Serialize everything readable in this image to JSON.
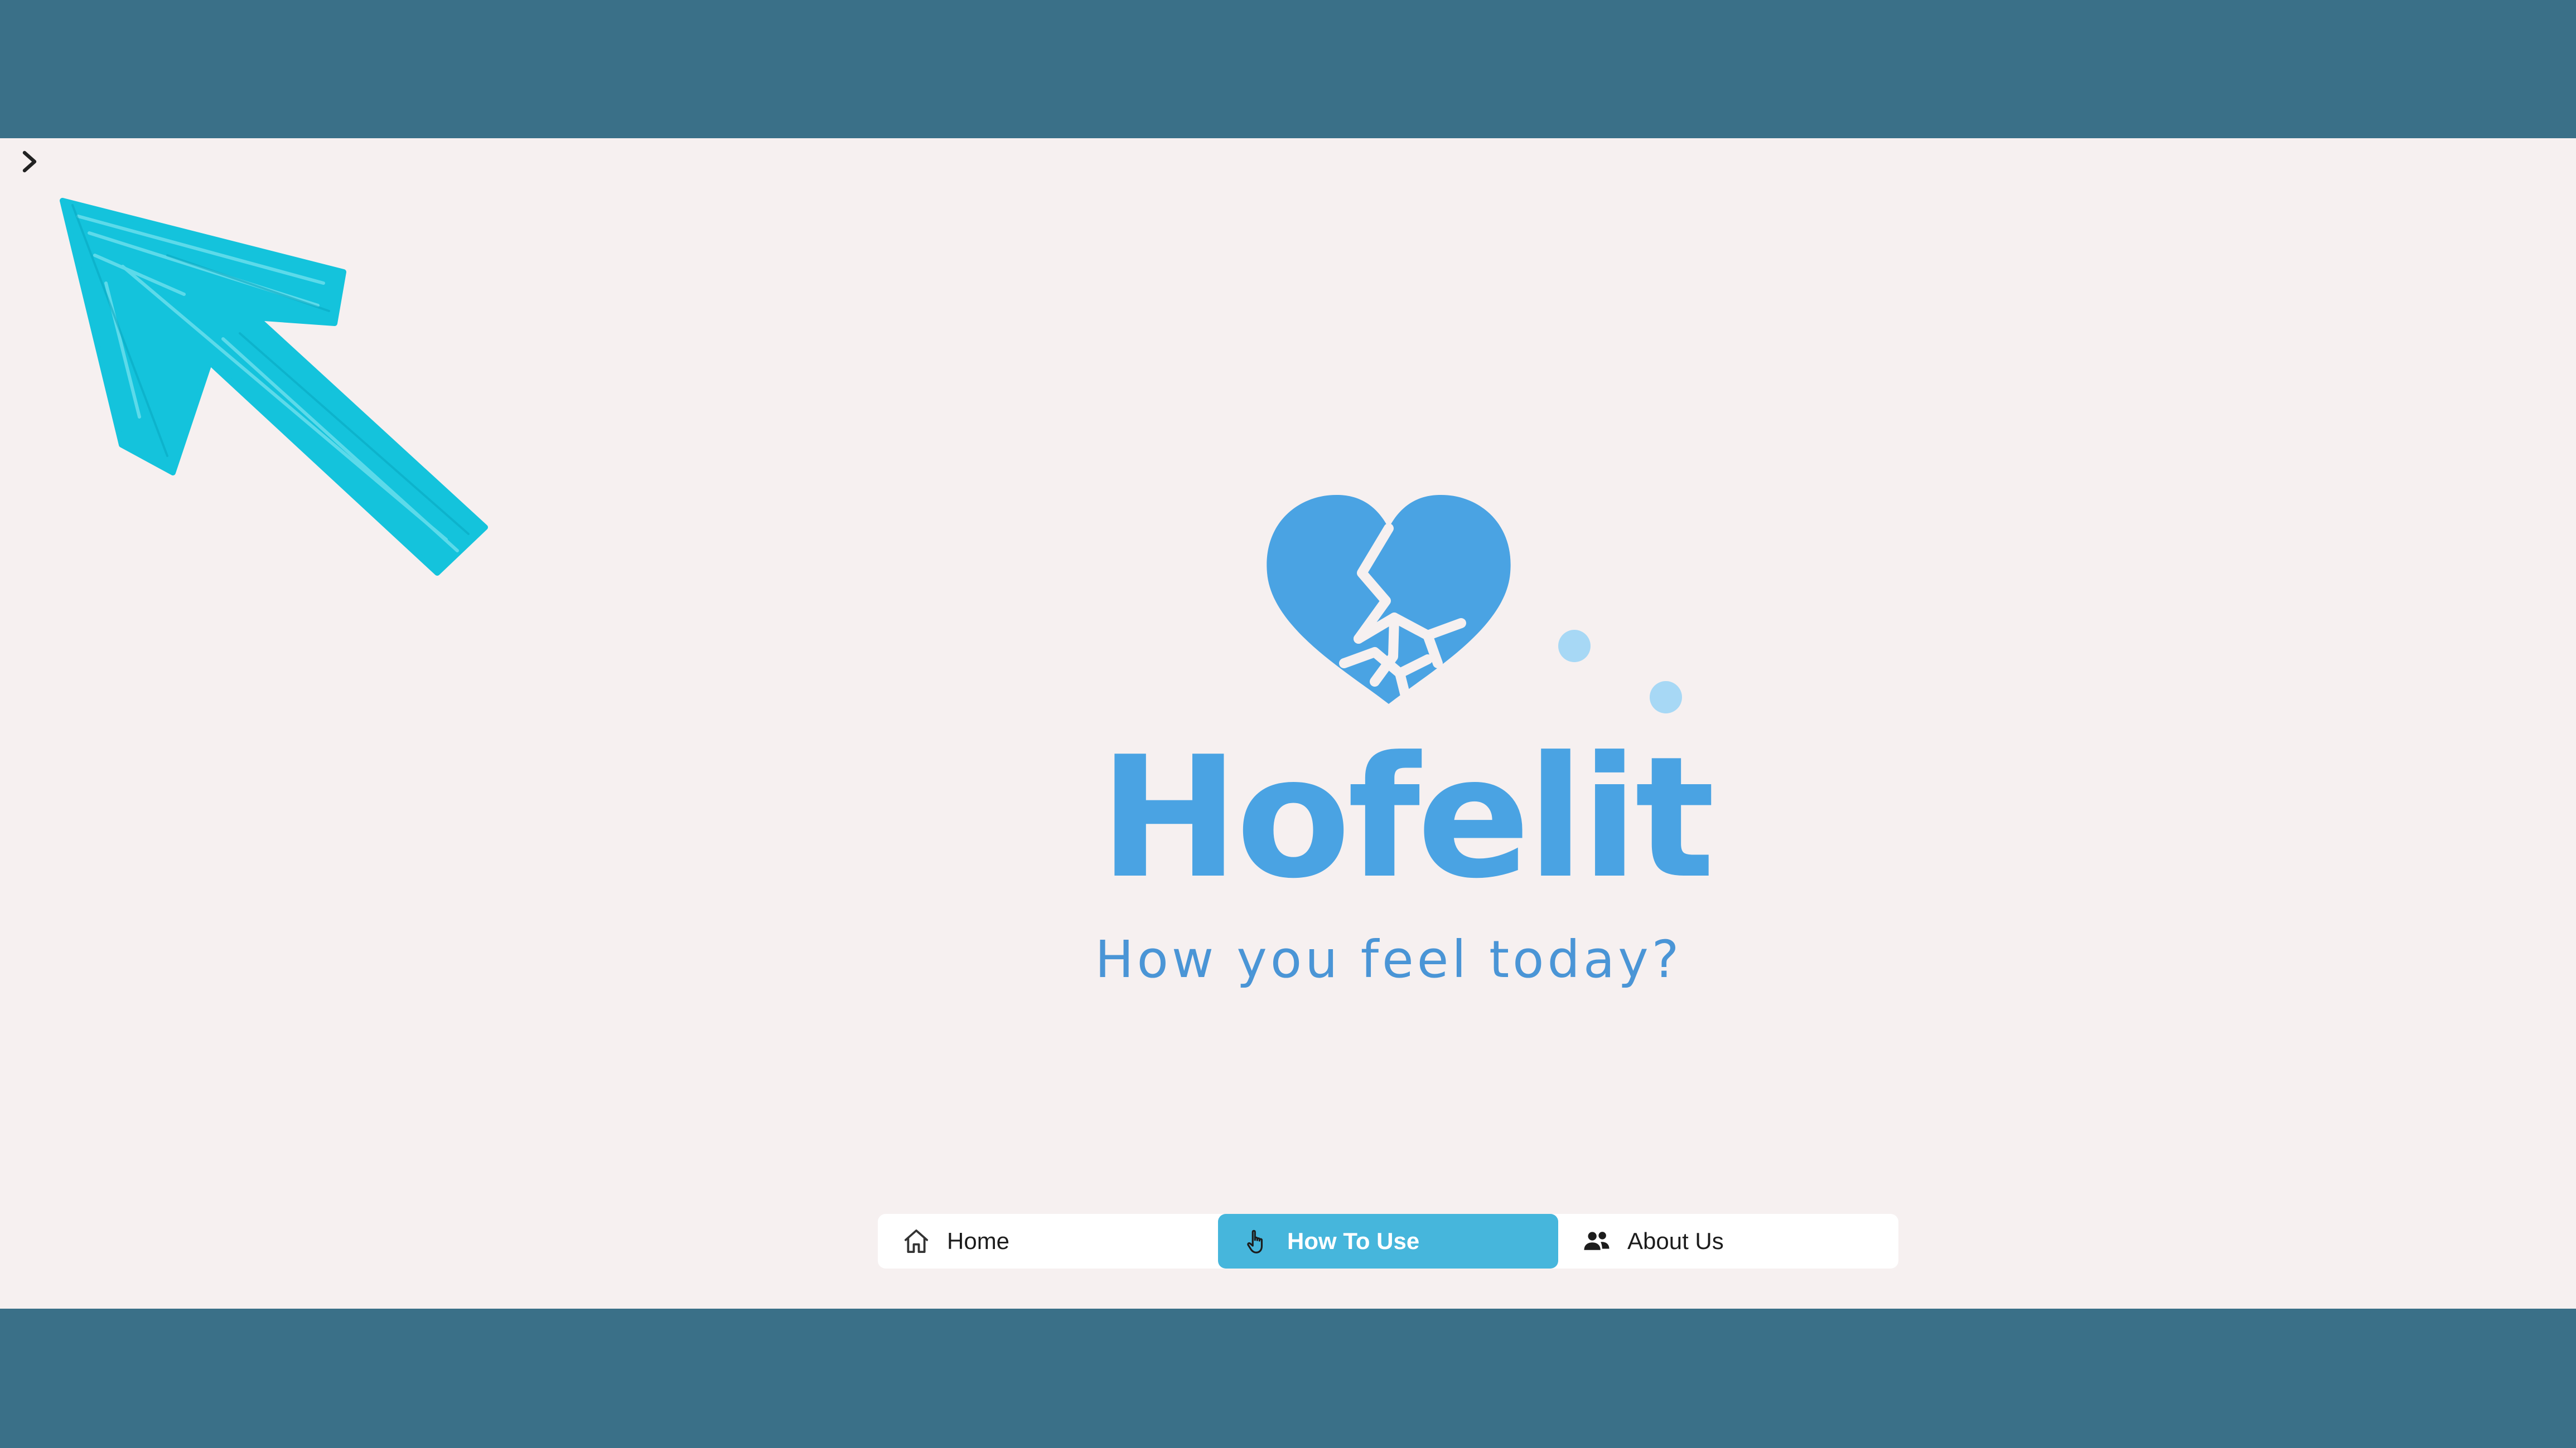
{
  "colors": {
    "frame": "#3a7088",
    "background": "#f6f0f0",
    "brand_blue": "#4aa3e3",
    "accent_dot": "#a7d8f5",
    "nav_active": "#46b6dc",
    "arrow": "#14c3dc"
  },
  "sidebar_toggle": {
    "icon": "chevron-right-icon"
  },
  "annotation": {
    "icon": "hand-drawn-arrow-icon"
  },
  "logo": {
    "icon": "broken-heart-icon",
    "name": "Hofelit",
    "tagline": "How you feel today?"
  },
  "nav": {
    "items": [
      {
        "label": "Home",
        "icon": "home-icon",
        "active": false
      },
      {
        "label": "How To Use",
        "icon": "pointer-hand-icon",
        "active": true
      },
      {
        "label": "About Us",
        "icon": "users-icon",
        "active": false
      }
    ]
  }
}
